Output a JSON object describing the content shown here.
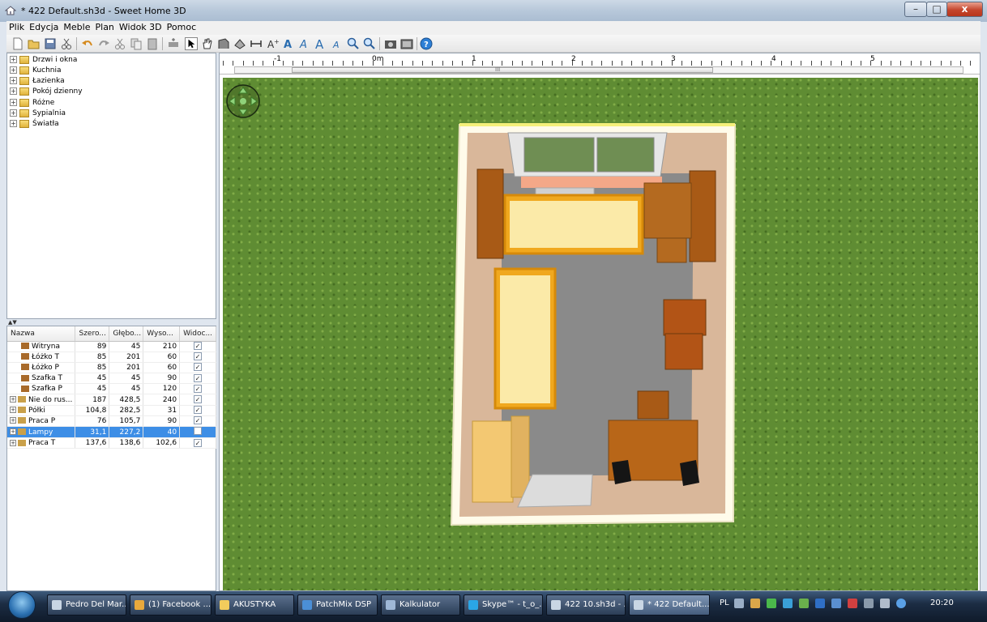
{
  "window": {
    "title": "* 422 Default.sh3d - Sweet Home 3D",
    "controls": {
      "minimize": "–",
      "maximize": "□",
      "close": "x"
    }
  },
  "menu": [
    "Plik",
    "Edycja",
    "Meble",
    "Plan",
    "Widok 3D",
    "Pomoc"
  ],
  "toolbar": {
    "icons": [
      "new-icon",
      "open-icon",
      "save-icon",
      "cut-icon",
      "undo-icon",
      "redo-icon",
      "cut-icon",
      "copy-icon",
      "paste-icon",
      "add-furniture-icon",
      "select-icon",
      "pan-icon",
      "create-walls-icon",
      "create-rooms-icon",
      "create-dimensions-icon",
      "add-text-icon",
      "bold-icon",
      "italic-icon",
      "increase-text-icon",
      "decrease-text-icon",
      "zoom-in-icon",
      "zoom-out-icon",
      "photo-icon",
      "video-icon",
      "help-icon"
    ]
  },
  "catalog": {
    "categories": [
      "Drzwi i okna",
      "Kuchnia",
      "Łazienka",
      "Pokój dzienny",
      "Różne",
      "Sypialnia",
      "Światła"
    ]
  },
  "furniture": {
    "columns": [
      "Nazwa",
      "Szero...",
      "Głębo...",
      "Wyso...",
      "Widoc..."
    ],
    "rows": [
      {
        "name": "Witryna",
        "w": "89",
        "d": "45",
        "h": "210",
        "visible": true,
        "group": false,
        "selected": false
      },
      {
        "name": "Łóżko T",
        "w": "85",
        "d": "201",
        "h": "60",
        "visible": true,
        "group": false,
        "selected": false
      },
      {
        "name": "Łóżko P",
        "w": "85",
        "d": "201",
        "h": "60",
        "visible": true,
        "group": false,
        "selected": false
      },
      {
        "name": "Szafka T",
        "w": "45",
        "d": "45",
        "h": "90",
        "visible": true,
        "group": false,
        "selected": false
      },
      {
        "name": "Szafka P",
        "w": "45",
        "d": "45",
        "h": "120",
        "visible": true,
        "group": false,
        "selected": false
      },
      {
        "name": "Nie do rus...",
        "w": "187",
        "d": "428,5",
        "h": "240",
        "visible": true,
        "group": true,
        "selected": false
      },
      {
        "name": "Półki",
        "w": "104,8",
        "d": "282,5",
        "h": "31",
        "visible": true,
        "group": true,
        "selected": false
      },
      {
        "name": "Praca P",
        "w": "76",
        "d": "105,7",
        "h": "90",
        "visible": true,
        "group": true,
        "selected": false
      },
      {
        "name": "Lampy",
        "w": "31,1",
        "d": "227,2",
        "h": "40",
        "visible": false,
        "group": true,
        "selected": true
      },
      {
        "name": "Praca T",
        "w": "137,6",
        "d": "138,6",
        "h": "102,6",
        "visible": true,
        "group": true,
        "selected": false
      }
    ]
  },
  "plan": {
    "ruler_labels": [
      "-1",
      "0m",
      "1",
      "2",
      "3",
      "4",
      "5"
    ],
    "scrollbar_mark": "III"
  },
  "taskbar": {
    "tasks": [
      {
        "label": "Pedro Del Mar...",
        "color": "#c9d6e4"
      },
      {
        "label": "(1) Facebook ...",
        "color": "#e9a93c"
      },
      {
        "label": "AKUSTYKA",
        "color": "#f2cc5c"
      },
      {
        "label": "PatchMix DSP",
        "color": "#4b8fd6"
      },
      {
        "label": "Kalkulator",
        "color": "#9fb8d6"
      },
      {
        "label": "Skype™ - t_o_...",
        "color": "#2aa6e6"
      },
      {
        "label": "422 10.sh3d - ...",
        "color": "#c9d6e4"
      },
      {
        "label": "* 422 Default....",
        "color": "#c9d6e4"
      }
    ],
    "language": "PL",
    "time": "20:20"
  }
}
